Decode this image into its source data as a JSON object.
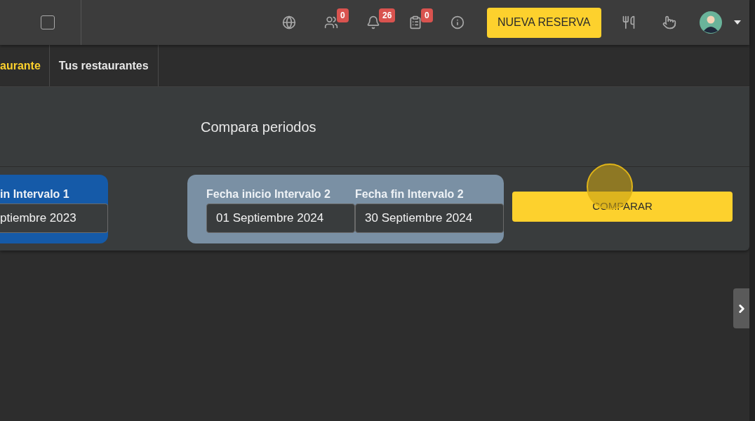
{
  "topbar": {
    "icons": [
      {
        "kind": "globe"
      },
      {
        "kind": "users",
        "badge": "0"
      },
      {
        "kind": "bell",
        "badge": "26"
      },
      {
        "kind": "clipboard",
        "badge": "0"
      },
      {
        "kind": "info"
      }
    ],
    "new_button": "NUEVA RESERVA",
    "right_icons": [
      {
        "kind": "utensils"
      },
      {
        "kind": "pointer"
      }
    ]
  },
  "tabs": [
    {
      "label": "aurante",
      "selected": true
    },
    {
      "label": "Tus restaurantes",
      "selected": false
    }
  ],
  "panel": {
    "title": "Compara periodos",
    "intervals": [
      {
        "color": "#155aa8",
        "fields": [
          {
            "label": "in Intervalo 1",
            "value": "ptiembre 2023"
          }
        ]
      },
      {
        "color": "#7a90a4",
        "fields": [
          {
            "label": "Fecha inicio Intervalo 2",
            "value": "01 Septiembre 2024"
          },
          {
            "label": "Fecha fin Intervalo 2",
            "value": "30 Septiembre 2024"
          }
        ]
      }
    ],
    "compare_button": "COMPARAR"
  }
}
